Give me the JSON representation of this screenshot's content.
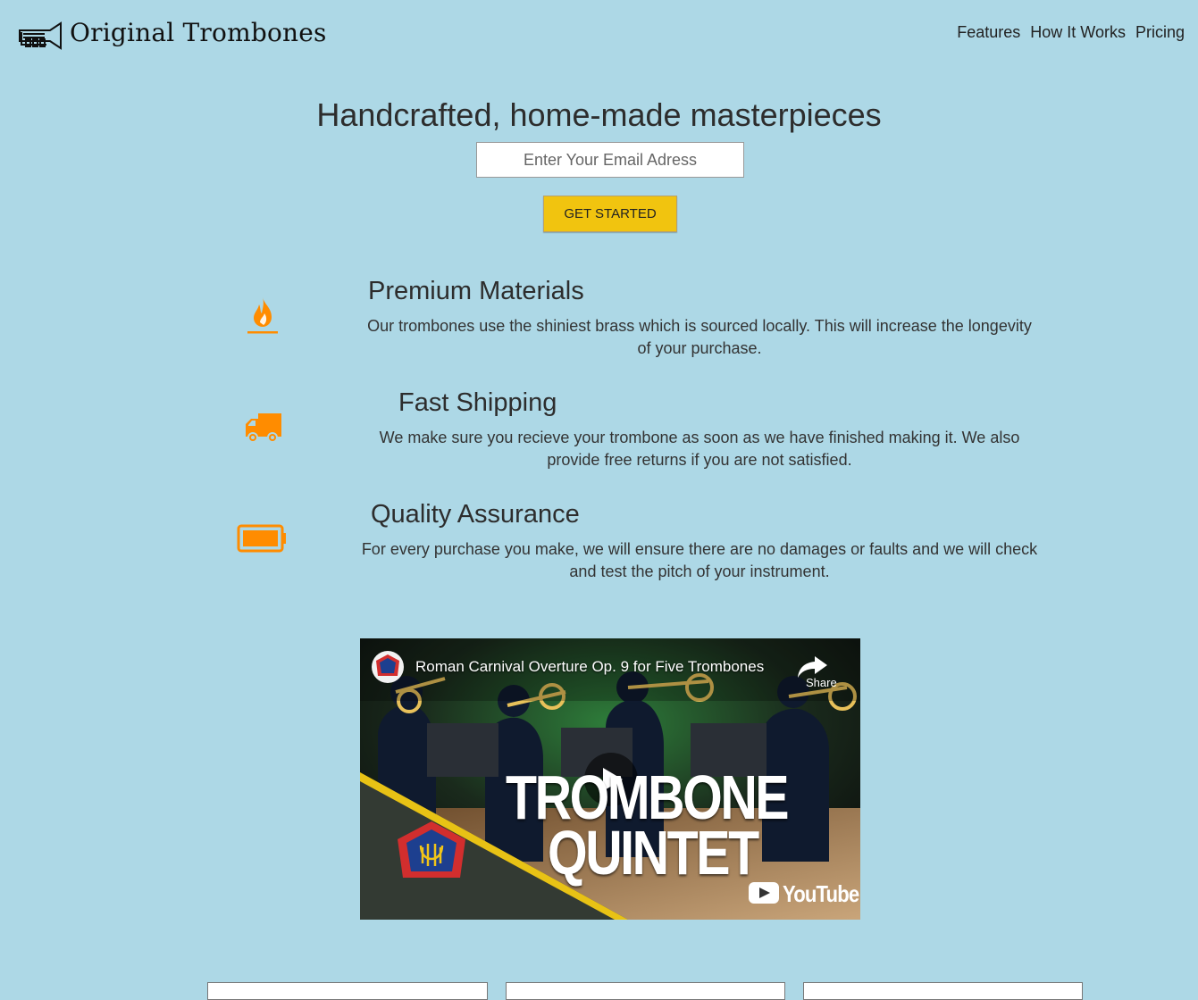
{
  "header": {
    "brand": "Original Trombones",
    "nav": [
      {
        "label": "Features"
      },
      {
        "label": "How It Works"
      },
      {
        "label": "Pricing"
      }
    ]
  },
  "hero": {
    "title": "Handcrafted, home-made masterpieces",
    "email_placeholder": "Enter Your Email Adress",
    "cta_label": "GET STARTED"
  },
  "features": [
    {
      "icon": "fire-icon",
      "title": "Premium Materials",
      "desc_line1": "Our trombones use the shiniest brass which is sourced locally. This will increase the longevity",
      "desc_line2": "of your purchase."
    },
    {
      "icon": "truck-icon",
      "title": "Fast Shipping",
      "desc_line1": "We make sure you recieve your trombone as soon as we have finished making it. We also",
      "desc_line2": "provide free returns if you are not satisfied."
    },
    {
      "icon": "battery-full-icon",
      "title": "Quality Assurance",
      "desc_line1": "For every purchase you make, we will ensure there are no damages or faults and we will check",
      "desc_line2": "and test the pitch of your instrument."
    }
  ],
  "video": {
    "title": "Roman Carnival Overture Op. 9 for Five Trombones",
    "share_label": "Share",
    "thumb_line1": "TROMBONE",
    "thumb_line2": "QUINTET",
    "platform": "YouTube"
  },
  "colors": {
    "background": "#add8e6",
    "accent": "#f1c40f",
    "icon": "#ff8c00"
  }
}
